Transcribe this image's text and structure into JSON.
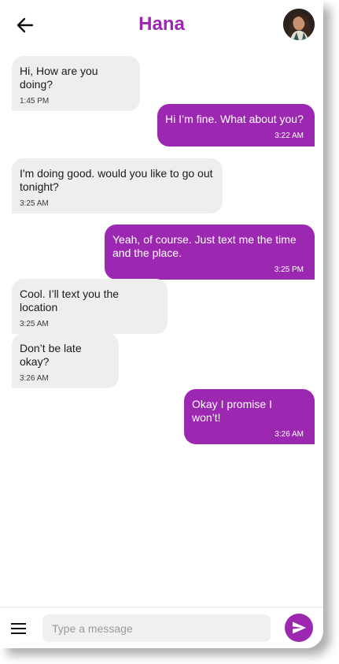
{
  "colors": {
    "accent": "#9c27b0",
    "outgoing_bubble": "#9c27b0",
    "incoming_bubble": "#eeeeee"
  },
  "header": {
    "back_icon": "arrow-left-icon",
    "title": "Hana",
    "avatar": "contact-avatar"
  },
  "messages": [
    {
      "direction": "in",
      "text": "Hi, How are you doing?",
      "time": "1:45 PM"
    },
    {
      "direction": "out",
      "text": "Hi I’m fine. What about you?",
      "time": "3:22 AM"
    },
    {
      "direction": "in",
      "text": "I'm doing good. would you like to go out tonight?",
      "time": "3:25 AM"
    },
    {
      "direction": "out",
      "text": "Yeah, of course. Just text me the time and the place.",
      "time": "3:25 PM"
    },
    {
      "direction": "in",
      "text": "Cool. I’ll text you the location",
      "time": "3:25 AM"
    },
    {
      "direction": "in",
      "text": "Don’t be late okay?",
      "time": "3:26 AM"
    },
    {
      "direction": "out",
      "text": "Okay I promise I won’t!",
      "time": "3:26 AM"
    }
  ],
  "composer": {
    "menu_icon": "hamburger-menu-icon",
    "placeholder": "Type a message",
    "value": "",
    "send_icon": "send-icon"
  }
}
